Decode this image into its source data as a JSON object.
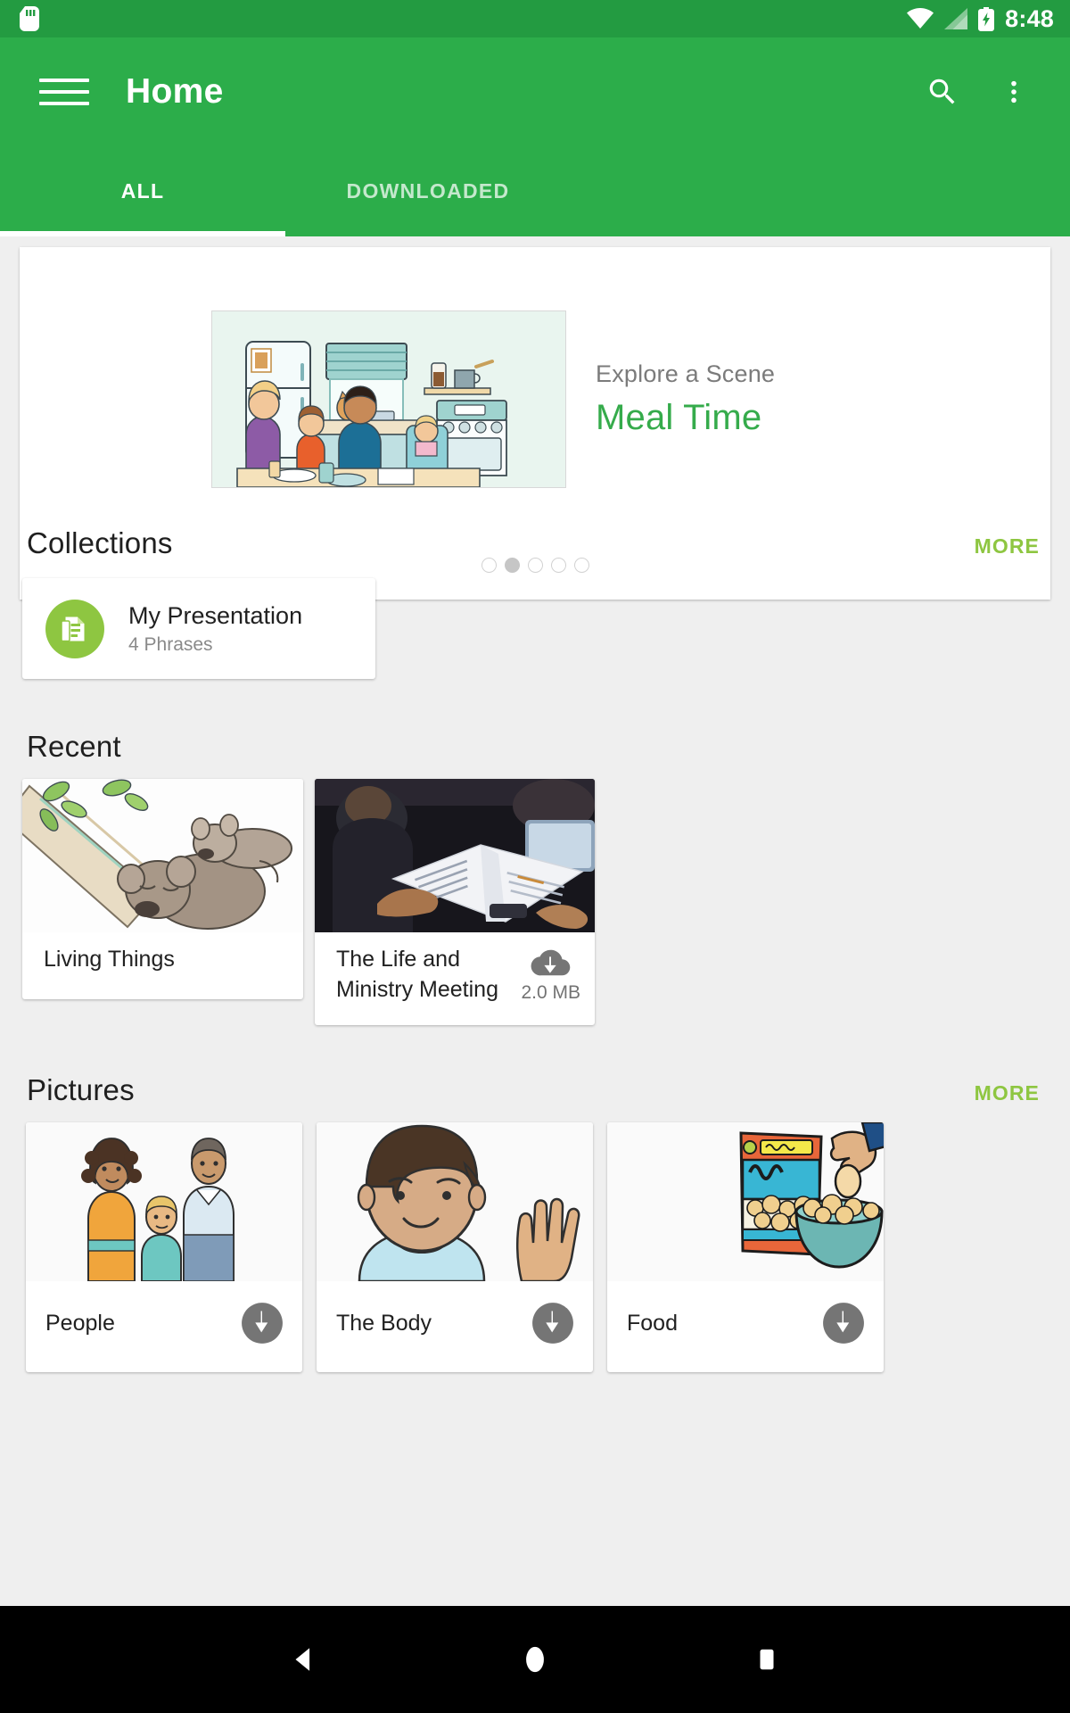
{
  "statusbar": {
    "sd_icon": "sd-card-icon",
    "wifi_icon": "wifi-icon",
    "signal_icon": "cellular-signal-icon",
    "battery_icon": "battery-charging-icon",
    "time": "8:48"
  },
  "appbar": {
    "menu_icon": "hamburger-menu-icon",
    "title": "Home",
    "search_icon": "search-icon",
    "overflow_icon": "more-vertical-icon",
    "tabs": [
      {
        "label": "ALL",
        "active": true
      },
      {
        "label": "DOWNLOADED",
        "active": false
      }
    ]
  },
  "hero": {
    "kicker": "Explore a Scene",
    "title": "Meal Time",
    "image_name": "meal-time-kitchen-illustration",
    "dots_total": 5,
    "dot_active_index": 1
  },
  "collections": {
    "heading": "Collections",
    "more_label": "MORE",
    "items": [
      {
        "icon": "presentation-document-icon",
        "name": "My Presentation",
        "subtitle": "4 Phrases",
        "accent": "#8ec641"
      }
    ]
  },
  "recent": {
    "heading": "Recent",
    "items": [
      {
        "title": "Living Things",
        "image_name": "koala-bears-tree-illustration",
        "download": null,
        "size": null
      },
      {
        "title": "The Life and Ministry Meeting",
        "image_name": "meeting-bible-study-photo",
        "download": "cloud-download-icon",
        "size": "2.0 MB"
      }
    ]
  },
  "pictures": {
    "heading": "Pictures",
    "more_label": "MORE",
    "items": [
      {
        "title": "People",
        "image_name": "family-people-illustration",
        "download": "download-circle-icon"
      },
      {
        "title": "The Body",
        "image_name": "boy-waving-illustration",
        "download": "download-circle-icon"
      },
      {
        "title": "Food",
        "image_name": "snack-bag-bowl-illustration",
        "download": "download-circle-icon"
      }
    ]
  },
  "navbar": {
    "back_icon": "navigation-back-icon",
    "home_icon": "navigation-home-icon",
    "recents_icon": "navigation-recents-icon"
  },
  "colors": {
    "status_green": "#239b41",
    "appbar_green": "#2cad4a",
    "accent_green": "#35ab4b",
    "more_green": "#8ec641",
    "page_bg": "#efefef"
  }
}
